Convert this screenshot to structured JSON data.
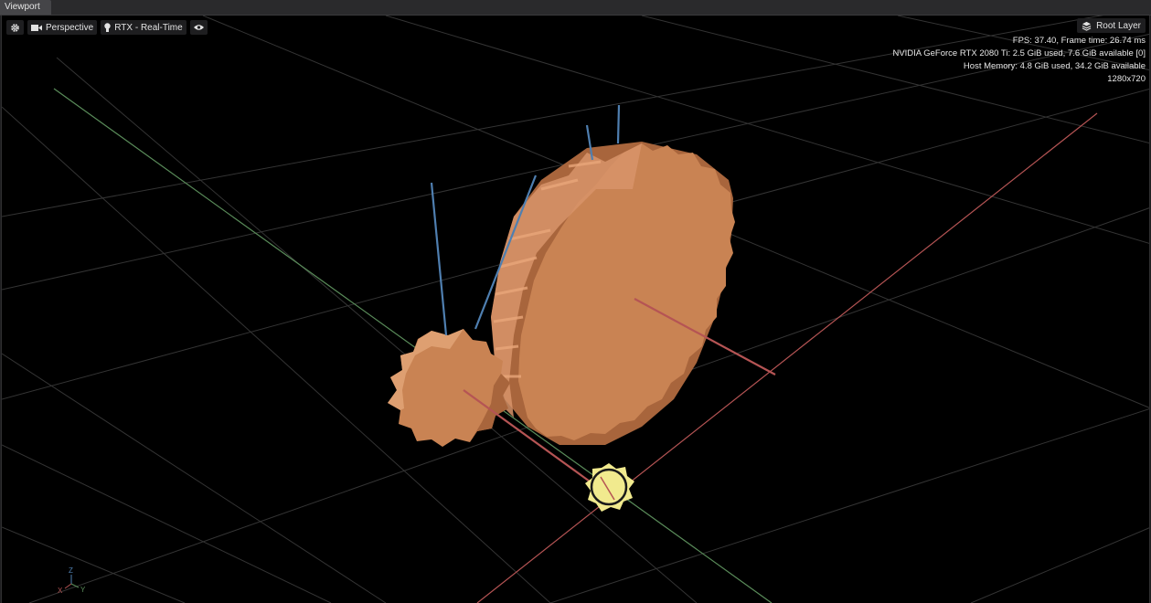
{
  "window": {
    "tab_title": "Viewport"
  },
  "toolbar": {
    "settings_icon": "gear-icon",
    "camera_icon": "video-camera-icon",
    "camera_label": "Perspective",
    "renderer_icon": "lightbulb-icon",
    "renderer_label": "RTX - Real-Time",
    "visibility_icon": "eye-icon"
  },
  "layer": {
    "icon": "layers-icon",
    "label": "Root Layer"
  },
  "stats": {
    "fps_line": "FPS: 37.40, Frame time: 26.74 ms",
    "gpu_line": "NVIDIA GeForce RTX 2080 Ti: 2.5 GiB used,  7.6 GiB available [0]",
    "host_line": "Host Memory: 4.8 GiB used, 34.2 GiB available",
    "resolution": "1280x720"
  },
  "axis_gizmo": {
    "z": "Z",
    "x": "X",
    "y": "Y"
  },
  "colors": {
    "gear": "#c98353",
    "gear_dark": "#a8653c",
    "axis_x": "#b55454",
    "axis_y": "#5a8c5a",
    "axis_z": "#4f7fb0",
    "light_gizmo": "#f1ea8e"
  }
}
